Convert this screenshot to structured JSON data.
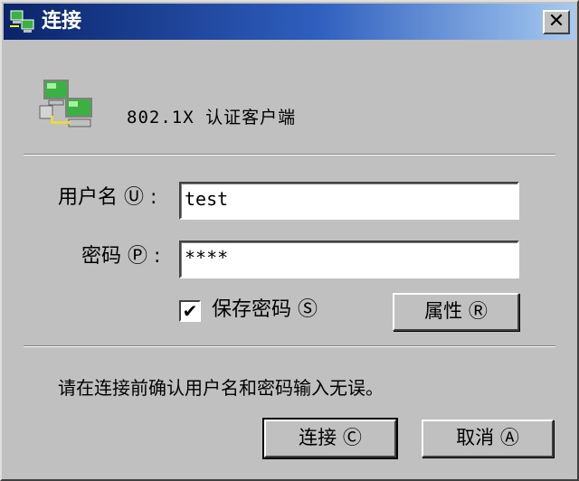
{
  "window": {
    "title": "连接",
    "close_glyph": "✕",
    "title_icon": "network-computers-icon",
    "close_icon": "close-icon"
  },
  "header": {
    "app_icon": "network-computers-icon",
    "app_name": "802.1X 认证客户端"
  },
  "form": {
    "username_label": "用户名",
    "username_mnemonic": "Ⓤ",
    "username_value": "test",
    "password_label": "密码",
    "password_mnemonic": "Ⓟ",
    "password_value": "****",
    "colon": ":",
    "save_password_label": "保存密码",
    "save_password_mnemonic": "Ⓢ",
    "save_password_checked": true,
    "check_glyph": "✔",
    "properties_label": "属性",
    "properties_mnemonic": "Ⓡ"
  },
  "hint": "请在连接前确认用户名和密码输入无误。",
  "buttons": {
    "connect_label": "连接",
    "connect_mnemonic": "Ⓒ",
    "cancel_label": "取消",
    "cancel_mnemonic": "Ⓐ"
  },
  "colors": {
    "titlebar": "#0a246a",
    "face": "#c0c0c0",
    "monitor_screen": "#3cb043"
  }
}
